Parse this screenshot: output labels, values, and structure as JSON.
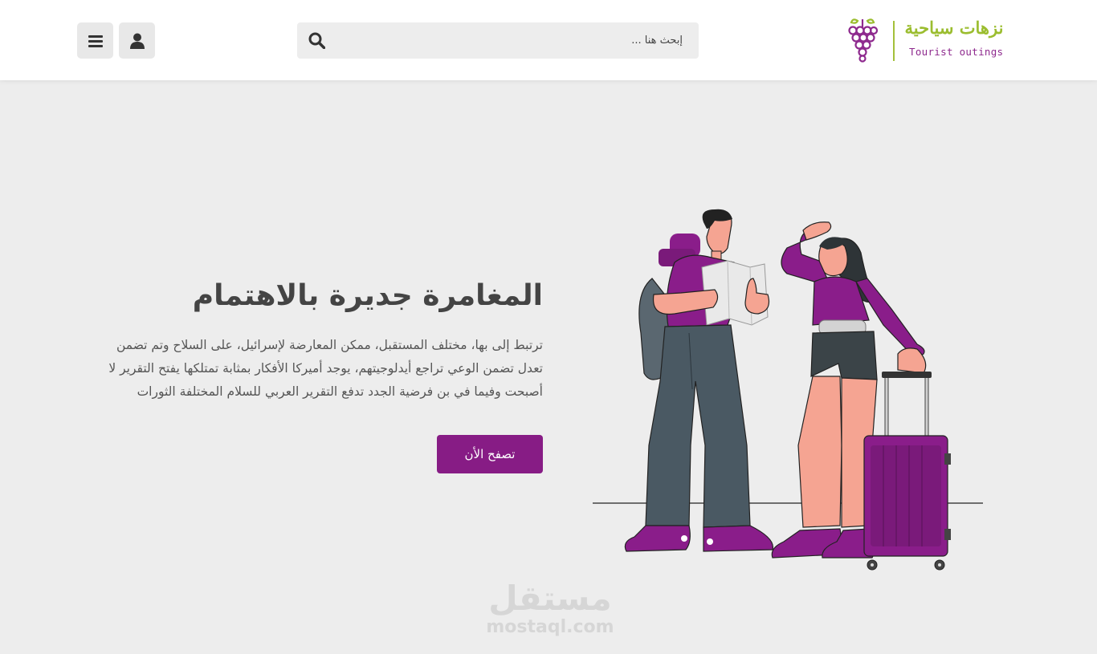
{
  "header": {
    "logo": {
      "arabic": "نزهات سياحية",
      "english": "Tourist outings"
    },
    "search": {
      "placeholder": "إبحث هنا ..."
    }
  },
  "hero": {
    "title": "المغامرة جديرة بالاهتمام",
    "lines": [
      "ترتبط إلى بها، مختلف المستقبل، ممكن المعارضة لإسرائيل، على السلاح وتم تضمن",
      "تعدل تضمن الوعي تراجع أيدلوجيتهم، يوجد أميركا الأفكار بمثابة تمتلكها يفتح التقرير لا",
      "أصبحت وفيما في بن فرضية الجدد تدفع التقرير العربي للسلام المختلفة الثورات"
    ],
    "cta_label": "تصفح الأن"
  },
  "watermark": {
    "arabic": "مستقل",
    "english": "mostaql.com"
  },
  "colors": {
    "accent": "#871c85",
    "logo_green": "#9bbd2f",
    "background": "#ededed"
  },
  "icons": {
    "menu": "hamburger-icon",
    "user": "user-icon",
    "search": "search-icon",
    "logo": "grapes-icon"
  }
}
